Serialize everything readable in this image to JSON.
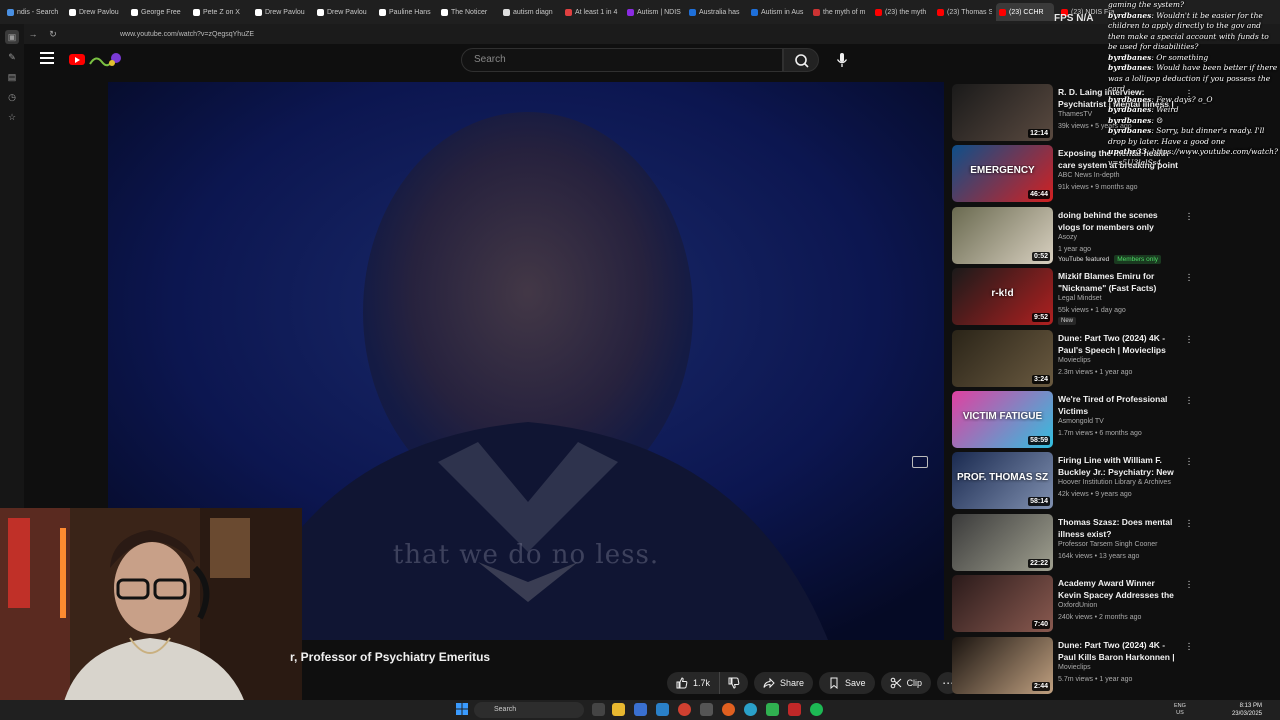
{
  "browser": {
    "tabs": [
      {
        "label": "ndis - Search",
        "color": "#4a90e2"
      },
      {
        "label": "Drew Pavlou",
        "color": "#ffffff"
      },
      {
        "label": "George Free",
        "color": "#ffffff"
      },
      {
        "label": "Pete Z on X",
        "color": "#ffffff"
      },
      {
        "label": "Drew Pavlou",
        "color": "#ffffff"
      },
      {
        "label": "Drew Pavlou",
        "color": "#ffffff"
      },
      {
        "label": "Pauline Hans",
        "color": "#ffffff"
      },
      {
        "label": "The Noticer",
        "color": "#ffffff"
      },
      {
        "label": "autism diagn",
        "color": "#dddddd"
      },
      {
        "label": "At least 1 in 4",
        "color": "#e04040"
      },
      {
        "label": "Autism | NDIS",
        "color": "#8a2be2"
      },
      {
        "label": "Australia has",
        "color": "#1e6fd9"
      },
      {
        "label": "Autism in Aus",
        "color": "#1e6fd9"
      },
      {
        "label": "the myth of m",
        "color": "#cc3333"
      },
      {
        "label": "(23) the myth",
        "color": "#ff0000"
      },
      {
        "label": "(23) Thomas S",
        "color": "#ff0000"
      },
      {
        "label": "(23) CCHR",
        "color": "#ff0000",
        "active": true
      },
      {
        "label": "(23) NDIS Fra",
        "color": "#ff0000"
      }
    ],
    "url": "www.youtube.com/watch?v=zQegsqYhuZE"
  },
  "header": {
    "search_placeholder": "Search"
  },
  "player": {
    "caption": "that we do no less."
  },
  "video": {
    "title": "r, Professor of Psychiatry Emeritus",
    "likes": "1.7k",
    "share_label": "Share",
    "save_label": "Save",
    "clip_label": "Clip"
  },
  "recommendations": [
    {
      "title": "R. D. Laing interview: Psychiatrist | Mental Illness |",
      "channel": "ThamesTV",
      "meta": "39k views • 5 years ago",
      "duration": "12:14",
      "colors": [
        "#1a1a1a",
        "#5a4a40"
      ]
    },
    {
      "title": "Exposing the mental health care system at breaking point | F...",
      "channel": "ABC News In-depth",
      "meta": "91k views • 9 months ago",
      "duration": "46:44",
      "colors": [
        "#0d4f8a",
        "#d32020"
      ],
      "overlay": "EMERGENCY"
    },
    {
      "title": "doing behind the scenes vlogs for members only",
      "channel": "Asozy",
      "meta": "1 year ago",
      "duration": "0:52",
      "colors": [
        "#6a6a50",
        "#d8d0c0"
      ],
      "badge": "YouTube featured",
      "badge2": "Members only"
    },
    {
      "title": "Mizkif Blames Emiru for \"Nickname\" (Fast Facts)",
      "channel": "Legal Mindset",
      "meta": "55k views • 1 day ago",
      "duration": "9:52",
      "colors": [
        "#1a1a1a",
        "#b02020"
      ],
      "overlay": "r-k!d",
      "tag": "New"
    },
    {
      "title": "Dune: Part Two (2024) 4K - Paul's Speech | Movieclips",
      "channel": "Movieclips",
      "meta": "2.3m views • 1 year ago",
      "duration": "3:24",
      "colors": [
        "#2a2418",
        "#6a5a40"
      ]
    },
    {
      "title": "We're Tired of Professional Victims",
      "channel": "Asmongold TV",
      "meta": "1.7m views • 6 months ago",
      "duration": "58:59",
      "colors": [
        "#e040a0",
        "#30c0e0"
      ],
      "overlay": "VICTIM FATIGUE"
    },
    {
      "title": "Firing Line with William F. Buckley Jr.: Psychiatry: New ...",
      "channel": "Hoover Institution Library & Archives",
      "meta": "42k views • 9 years ago",
      "duration": "58:14",
      "colors": [
        "#1a2a50",
        "#8090b0"
      ],
      "overlay": "PROF. THOMAS SZ"
    },
    {
      "title": "Thomas Szasz: Does mental illness exist?",
      "channel": "Professor Tarsem Singh Cooner",
      "meta": "164k views • 13 years ago",
      "duration": "22:22",
      "colors": [
        "#3a3a3a",
        "#a0a090"
      ]
    },
    {
      "title": "Academy Award Winner Kevin Spacey Addresses the Oxford ...",
      "channel": "OxfordUnion",
      "meta": "240k views • 2 months ago",
      "duration": "7:40",
      "colors": [
        "#2a1a1a",
        "#8a5a50"
      ]
    },
    {
      "title": "Dune: Part Two (2024) 4K - Paul Kills Baron Harkonnen | ...",
      "channel": "Movieclips",
      "meta": "5.7m views • 1 year ago",
      "duration": "2:44",
      "colors": [
        "#1a1410",
        "#c0a080"
      ]
    }
  ],
  "chat": [
    {
      "user": "",
      "text": "gaming the system?"
    },
    {
      "user": "byrdbanes",
      "text": "Wouldn't it be easier for the children to apply directly to the gov and then make a special account with funds to be used for disabilities?"
    },
    {
      "user": "byrdbanes",
      "text": "Or something"
    },
    {
      "user": "byrdbanes",
      "text": "Would have been better if there was a lollipop deduction if you possess the card"
    },
    {
      "user": "byrdbanes",
      "text": "Few days? o_O"
    },
    {
      "user": "byrdbanes",
      "text": "Weird"
    },
    {
      "user": "byrdbanes",
      "text": "☹"
    },
    {
      "user": "byrdbanes",
      "text": "Sorry, but dinner's ready. I'll drop by later. Have a good one"
    },
    {
      "user": "upathr33",
      "text": "https://www.youtube.com/watch?v=s5U3lalSs4"
    }
  ],
  "overlay": {
    "fps_label": "FPS",
    "fps_value": "N/A"
  },
  "taskbar": {
    "search_label": "Search",
    "lang_line1": "ENG",
    "lang_line2": "US",
    "time": "8:13 PM",
    "date": "23/03/2025"
  }
}
